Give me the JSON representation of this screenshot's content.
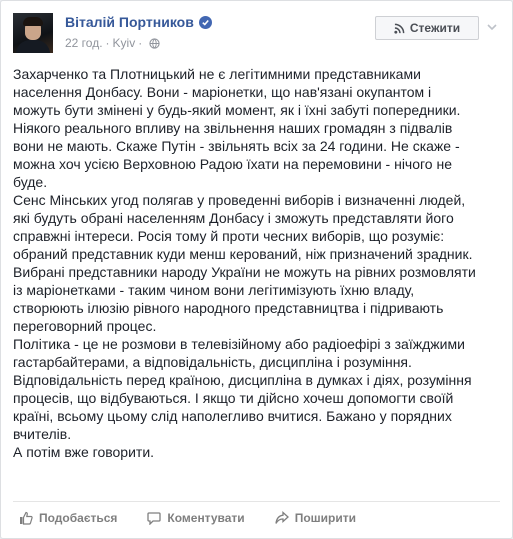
{
  "post": {
    "author_name": "Віталій Портников",
    "time": "22 год.",
    "location": "Kyiv",
    "separator": "·",
    "follow_label": "Стежити",
    "paragraphs": [
      "Захарченко та Плотницький не є легітимними представниками населення Донбасу. Вони - маріонетки, що нав'язані окупантом і можуть бути змінені у будь-який момент, як і їхні забуті попередники. Ніякого реального впливу на звільнення наших громадян з підвалів вони не мають. Скаже Путін - звільнять всіх за 24 години. Не скаже - можна хоч усією Верховною Радою їхати на перемовини - нічого не буде.",
      "Сенс Мінських угод полягав у проведенні виборів і визначенні людей, які будуть обрані населенням Донбасу і зможуть представляти його справжні інтереси. Росія тому й проти чесних виборів, що розуміє: обраний представник куди менш керований, ніж призначений зрадник. Вибрані представники народу України не можуть на рівних розмовляти із маріонетками - таким чином вони легітимізують їхню владу, створюють ілюзію рівного народного представництва і підривають переговорний процес.",
      "Політика - це не розмови в телевізійному або радіоефірі з заїжджими гастарбайтерами, а відповідальність, дисципліна і розуміння. Відповідальність перед країною, дисципліна в думках і діях, розуміння процесів, що відбуваються. І якщо ти дійсно хочеш допомогти своїй країні, всьому цьому слід наполегливо вчитися. Бажано у порядних вчителів.",
      "А потім вже говорити."
    ]
  },
  "actions": {
    "like_label": "Подобається",
    "comment_label": "Коментувати",
    "share_label": "Поширити"
  },
  "colors": {
    "name_link": "#365899",
    "verified_badge": "#4267b2",
    "meta_gray": "#90949c"
  },
  "icons": [
    "verified-badge-icon",
    "globe-icon",
    "rss-icon",
    "chevron-down-icon",
    "thumbs-up-icon",
    "comment-icon",
    "share-icon"
  ]
}
